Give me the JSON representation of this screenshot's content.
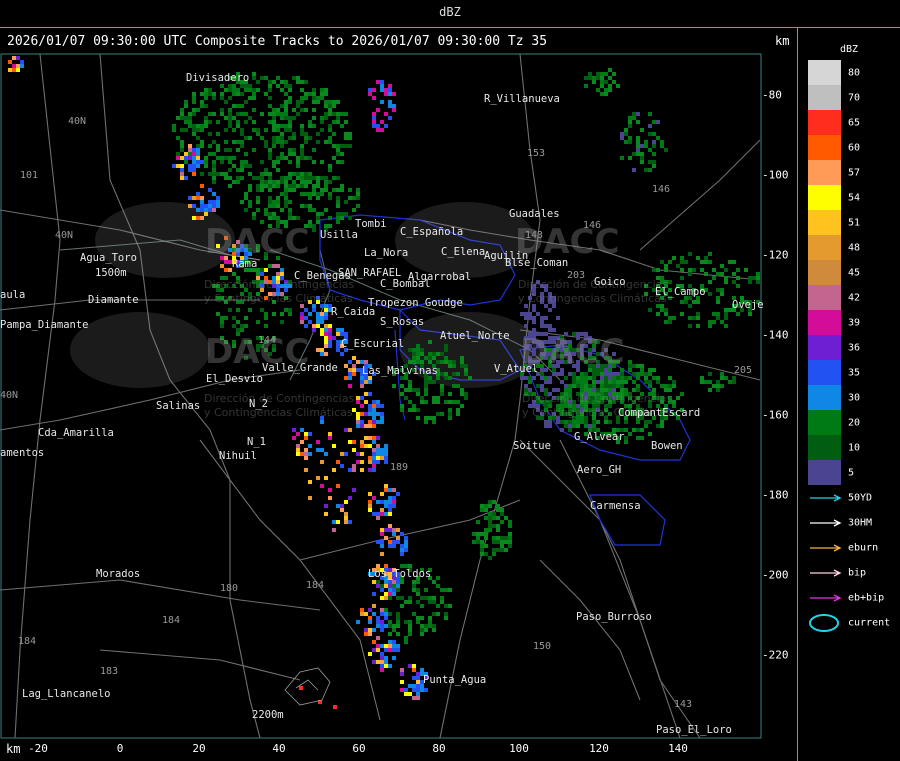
{
  "top_title": "dBZ",
  "header_text": "2026/01/07 09:30:00 UTC Composite Tracks to 2026/01/07 09:30:00 Tz 35",
  "unit": "km",
  "x_ticks": [
    "-20",
    "0",
    "20",
    "40",
    "60",
    "80",
    "100",
    "120",
    "140"
  ],
  "y_ticks": [
    "-80",
    "-100",
    "-120",
    "-140",
    "-160",
    "-180",
    "-200",
    "-220"
  ],
  "places": [
    {
      "label": "Divisadero"
    },
    {
      "label": "R_Villanueva"
    },
    {
      "label": "Guadales"
    },
    {
      "label": "Tombi"
    },
    {
      "label": "Usilla"
    },
    {
      "label": "C_Española"
    },
    {
      "label": "La_Nora"
    },
    {
      "label": "C_Elena"
    },
    {
      "label": "Aguilin"
    },
    {
      "label": "Blse_Coman"
    },
    {
      "label": "SAN_RAFAEL"
    },
    {
      "label": "C_Benegas"
    },
    {
      "label": "C_Bombal"
    },
    {
      "label": "Algarrobal"
    },
    {
      "label": "Tropezon Goudge"
    },
    {
      "label": "R_Caida"
    },
    {
      "label": "S_Rosas"
    },
    {
      "label": "Atuel_Norte"
    },
    {
      "label": "C_Escurial"
    },
    {
      "label": "Las_Malvinas"
    },
    {
      "label": "Valle_Grande"
    },
    {
      "label": "El_Desvio"
    },
    {
      "label": "Salinas"
    },
    {
      "label": "Cda_Amarilla"
    },
    {
      "label": "Nihuil"
    },
    {
      "label": "Morados"
    },
    {
      "label": "Agua_Toro"
    },
    {
      "label": "Pampa_Diamante"
    },
    {
      "label": "Lag_Llancanelo"
    },
    {
      "label": "Punta_Agua"
    },
    {
      "label": "Los_Toldos"
    },
    {
      "label": "Soitue"
    },
    {
      "label": "Aero_GH"
    },
    {
      "label": "Carmensa"
    },
    {
      "label": "Paso_Burroso"
    },
    {
      "label": "Paso_El_Loro"
    },
    {
      "label": "Goico"
    },
    {
      "label": "El_Campo"
    },
    {
      "label": "Oveje"
    },
    {
      "label": "V_Atuel"
    },
    {
      "label": "G_Alvear"
    },
    {
      "label": "Bowen"
    },
    {
      "label": "CompantEscard"
    },
    {
      "label": "Rama"
    },
    {
      "label": "1500m"
    },
    {
      "label": "2200m"
    },
    {
      "label": "Diamante"
    },
    {
      "label": "aula"
    },
    {
      "label": "amentos"
    },
    {
      "label": "N_1"
    },
    {
      "label": "N_2"
    }
  ],
  "roads": [
    "40N",
    "101",
    "40N",
    "153",
    "143",
    "146",
    "203",
    "205",
    "180",
    "184",
    "184",
    "150",
    "183",
    "184",
    "143",
    "146",
    "144",
    "189",
    "40N"
  ],
  "watermark": {
    "logo_text": "DACC",
    "subtitle": "Dirección de Contingencias",
    "subtitle2": "y Contingencias Climáticas"
  },
  "legend": {
    "title": "dBZ",
    "scale": [
      {
        "label": "80",
        "color": "#d6d6d6"
      },
      {
        "label": "70",
        "color": "#bfbfbf"
      },
      {
        "label": "65",
        "color": "#ff2d1e"
      },
      {
        "label": "60",
        "color": "#ff5a00"
      },
      {
        "label": "57",
        "color": "#ff9b57"
      },
      {
        "label": "54",
        "color": "#fffe00"
      },
      {
        "label": "51",
        "color": "#ffc21e"
      },
      {
        "label": "48",
        "color": "#e59a2f"
      },
      {
        "label": "45",
        "color": "#cf8a3b"
      },
      {
        "label": "42",
        "color": "#c4658f"
      },
      {
        "label": "39",
        "color": "#d40c9a"
      },
      {
        "label": "36",
        "color": "#6f1fd2"
      },
      {
        "label": "35",
        "color": "#2352f3"
      },
      {
        "label": "30",
        "color": "#0f87e5"
      },
      {
        "label": "20",
        "color": "#007a14"
      },
      {
        "label": "10",
        "color": "#005e10"
      },
      {
        "label": "5",
        "color": "#4b4491"
      }
    ],
    "tracks": [
      {
        "label": "50YD",
        "color": "#22d3e6"
      },
      {
        "label": "30HM",
        "color": "#ffffff"
      },
      {
        "label": "eburn",
        "color": "#f5b342"
      },
      {
        "label": "bip",
        "color": "#ffd2e6"
      },
      {
        "label": "eb+bip",
        "color": "#e633e6"
      },
      {
        "label": "current",
        "color": "#22d3e6"
      }
    ]
  }
}
